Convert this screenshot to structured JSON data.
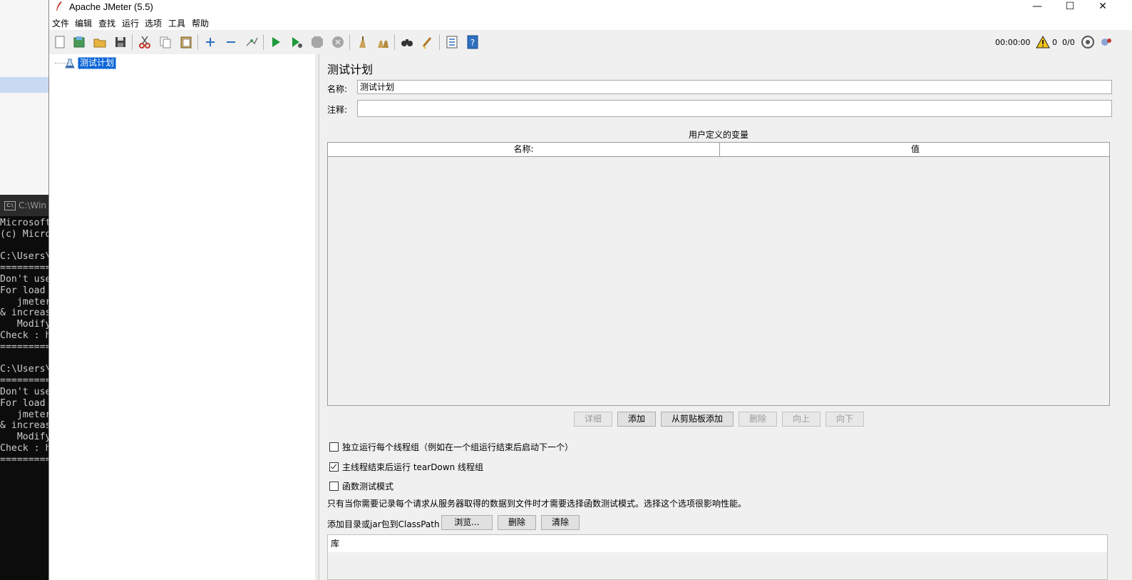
{
  "console": {
    "title": "C:\\Win",
    "lines": [
      "Microsoft",
      "(c) Micro",
      "",
      "C:\\Users\\",
      "=========",
      "Don't use",
      "For load ",
      "   jmeter",
      "& increas",
      "   Modify",
      "Check : h",
      "=========",
      "",
      "C:\\Users\\",
      "=========",
      "Don't use",
      "For load ",
      "   jmeter",
      "& increas",
      "   Modify",
      "Check : h",
      "========="
    ]
  },
  "window": {
    "title": "Apache JMeter (5.5)",
    "minimize_glyph": "—",
    "maximize_glyph": "☐",
    "close_glyph": "✕"
  },
  "menu": {
    "items": [
      "文件",
      "编辑",
      "查找",
      "运行",
      "选项",
      "工具",
      "帮助"
    ]
  },
  "toolbar": {
    "timer": "00:00:00",
    "warning_count": "0",
    "threads": "0/0",
    "icons": [
      "new-icon",
      "templates-icon",
      "open-icon",
      "save-icon",
      "cut-icon",
      "copy-icon",
      "paste-icon",
      "expand-icon",
      "collapse-icon",
      "toggle-icon",
      "start-icon",
      "start-no-pauses-icon",
      "stop-icon",
      "shutdown-icon",
      "clear-icon",
      "clear-all-icon",
      "search-icon",
      "reset-search-icon",
      "function-helper-icon",
      "help-icon"
    ]
  },
  "tree": {
    "root_label": "测试计划"
  },
  "test_plan": {
    "heading": "测试计划",
    "name_label": "名称:",
    "name_value": "测试计划",
    "comment_label": "注释:",
    "comment_value": "",
    "vars_title": "用户定义的变量",
    "col_name": "名称:",
    "col_value": "值",
    "buttons": {
      "detail": "详细",
      "add": "添加",
      "add_clipboard": "从剪贴板添加",
      "delete": "删除",
      "up": "向上",
      "down": "向下"
    },
    "options": {
      "serialize": {
        "label": "独立运行每个线程组（例如在一个组运行结束后启动下一个）",
        "checked": false
      },
      "teardown": {
        "label": "主线程结束后运行 tearDown 线程组",
        "checked": true
      },
      "functional": {
        "label": "函数测试模式",
        "checked": false
      }
    },
    "functional_note": "只有当你需要记录每个请求从服务器取得的数据到文件时才需要选择函数测试模式。选择这个选项很影响性能。",
    "classpath_label": "添加目录或jar包到ClassPath",
    "classpath_buttons": {
      "browse": "浏览...",
      "delete": "删除",
      "clear": "清除"
    },
    "library_header": "库"
  }
}
